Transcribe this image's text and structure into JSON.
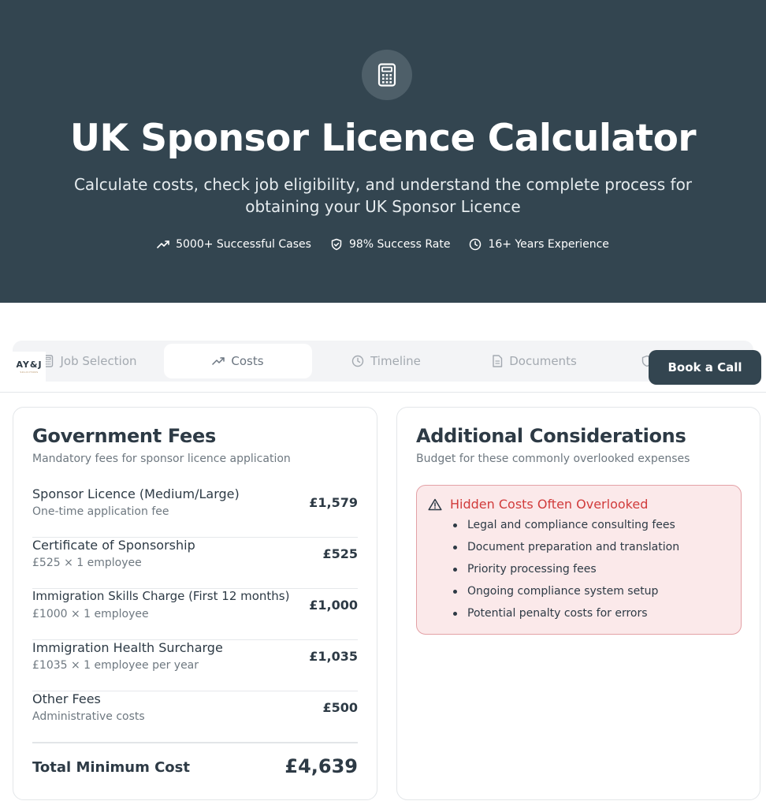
{
  "hero": {
    "icon": "calculator-icon",
    "title": "UK Sponsor Licence Calculator",
    "subtitle": "Calculate costs, check job eligibility, and understand the complete process for obtaining your UK Sponsor Licence",
    "stats": [
      {
        "icon": "trending-up-icon",
        "label": "5000+ Successful Cases"
      },
      {
        "icon": "shield-check-icon",
        "label": "98% Success Rate"
      },
      {
        "icon": "clock-icon",
        "label": "16+ Years Experience"
      }
    ]
  },
  "logo": {
    "text": "AY&J",
    "subtext": "SOLICITORS"
  },
  "tabs": [
    {
      "label": "Job Selection",
      "icon": "calculator-icon",
      "active": false
    },
    {
      "label": "Costs",
      "icon": "trending-up-icon",
      "active": true
    },
    {
      "label": "Timeline",
      "icon": "clock-icon",
      "active": false
    },
    {
      "label": "Documents",
      "icon": "document-icon",
      "active": false
    },
    {
      "label": "",
      "icon": "shield-icon",
      "active": false
    }
  ],
  "book_call": {
    "label": "Book a Call"
  },
  "government_fees": {
    "title": "Government Fees",
    "description": "Mandatory fees for sponsor licence application",
    "rows": [
      {
        "name": "Sponsor Licence (Medium/Large)",
        "detail": "One-time application fee",
        "amount": "£1,579"
      },
      {
        "name": "Certificate of Sponsorship",
        "detail": "£525 × 1 employee",
        "amount": "£525"
      },
      {
        "name": "Immigration Skills Charge (First 12 months)",
        "detail": "£1000 × 1 employee",
        "amount": "£1,000"
      },
      {
        "name": "Immigration Health Surcharge",
        "detail": "£1035 × 1 employee per year",
        "amount": "£1,035"
      },
      {
        "name": "Other Fees",
        "detail": "Administrative costs",
        "amount": "£500"
      }
    ],
    "total_label": "Total Minimum Cost",
    "total_amount": "£4,639"
  },
  "additional": {
    "title": "Additional Considerations",
    "description": "Budget for these commonly overlooked expenses",
    "alert": {
      "icon": "warning-triangle-icon",
      "title": "Hidden Costs Often Overlooked",
      "items": [
        "Legal and compliance consulting fees",
        "Document preparation and translation",
        "Priority processing fees",
        "Ongoing compliance system setup",
        "Potential penalty costs for errors"
      ]
    }
  },
  "colors": {
    "hero_bg": "#334550",
    "accent": "#334550",
    "alert_bg": "#fbe9ea",
    "alert_text": "#d13b3b"
  }
}
